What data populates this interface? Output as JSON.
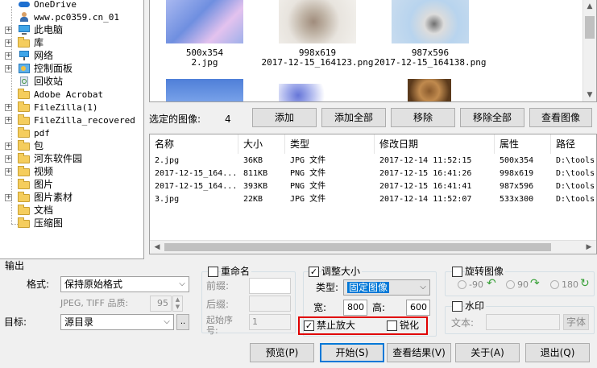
{
  "tree": {
    "items": [
      {
        "label": "OneDrive",
        "icon": "cloud-icon",
        "mono": true,
        "expander": "",
        "indent": 0
      },
      {
        "label": "www.pc0359.cn_01",
        "icon": "user-icon",
        "mono": true,
        "expander": "",
        "indent": 0
      },
      {
        "label": "此电脑",
        "icon": "computer-icon",
        "mono": false,
        "expander": "+",
        "indent": 0
      },
      {
        "label": "库",
        "icon": "library-folder-icon",
        "mono": false,
        "expander": "+",
        "indent": 0
      },
      {
        "label": "网络",
        "icon": "network-icon",
        "mono": false,
        "expander": "+",
        "indent": 0
      },
      {
        "label": "控制面板",
        "icon": "control-panel-icon",
        "mono": false,
        "expander": "+",
        "indent": 0
      },
      {
        "label": "回收站",
        "icon": "recycle-bin-icon",
        "mono": false,
        "expander": "",
        "indent": 0
      },
      {
        "label": "Adobe Acrobat",
        "icon": "folder-icon",
        "mono": true,
        "expander": "",
        "indent": 0
      },
      {
        "label": "FileZilla(1)",
        "icon": "folder-icon",
        "mono": true,
        "expander": "+",
        "indent": 0
      },
      {
        "label": "FileZilla_recovered",
        "icon": "folder-icon",
        "mono": true,
        "expander": "+",
        "indent": 0
      },
      {
        "label": "pdf",
        "icon": "folder-icon",
        "mono": true,
        "expander": "",
        "indent": 0
      },
      {
        "label": "包",
        "icon": "folder-icon",
        "mono": false,
        "expander": "+",
        "indent": 0
      },
      {
        "label": "河东软件园",
        "icon": "folder-icon",
        "mono": false,
        "expander": "+",
        "indent": 0
      },
      {
        "label": "视频",
        "icon": "folder-icon",
        "mono": false,
        "expander": "+",
        "indent": 0
      },
      {
        "label": "图片",
        "icon": "folder-icon",
        "mono": false,
        "expander": "",
        "indent": 0
      },
      {
        "label": "图片素材",
        "icon": "folder-icon",
        "mono": false,
        "expander": "+",
        "indent": 0
      },
      {
        "label": "文档",
        "icon": "folder-icon",
        "mono": false,
        "expander": "",
        "indent": 0
      },
      {
        "label": "压缩图",
        "icon": "folder-icon",
        "mono": false,
        "expander": "",
        "indent": 0
      }
    ]
  },
  "thumbs": [
    {
      "size": "500x354",
      "name": "2.jpg",
      "color": "#8fa8e8"
    },
    {
      "size": "998x619",
      "name": "2017-12-15_164123.png",
      "color": "#d8d2c8"
    },
    {
      "size": "987x596",
      "name": "2017-12-15_164138.png",
      "color": "#b9d0e8"
    }
  ],
  "selected": {
    "label": "选定的图像:",
    "count": "4"
  },
  "buttons": {
    "add": "添加",
    "add_all": "添加全部",
    "remove": "移除",
    "remove_all": "移除全部",
    "view": "查看图像"
  },
  "list": {
    "headers": [
      "名称",
      "大小",
      "类型",
      "修改日期",
      "属性",
      "路径"
    ],
    "rows": [
      [
        "2.jpg",
        "36KB",
        "JPG 文件",
        "2017-12-14 11:52:15",
        "500x354",
        "D:\\tools"
      ],
      [
        "2017-12-15_164...",
        "811KB",
        "PNG 文件",
        "2017-12-15 16:41:26",
        "998x619",
        "D:\\tools"
      ],
      [
        "2017-12-15_164...",
        "393KB",
        "PNG 文件",
        "2017-12-15 16:41:41",
        "987x596",
        "D:\\tools"
      ],
      [
        "3.jpg",
        "22KB",
        "JPG 文件",
        "2017-12-14 11:52:07",
        "533x300",
        "D:\\tools"
      ]
    ]
  },
  "output": {
    "title": "输出",
    "format_label": "格式:",
    "format_value": "保持原始格式",
    "quality_label": "JPEG, TIFF 品质:",
    "quality_value": "95",
    "target_label": "目标:",
    "target_value": "源目录",
    "browse": ".."
  },
  "rename": {
    "label": "重命名",
    "prefix": "前缀:",
    "suffix": "后缀:",
    "start_seq": "起始序号:",
    "start_value": "1"
  },
  "resize": {
    "label": "调整大小",
    "type_label": "类型:",
    "type_value": "固定图像",
    "width_label": "宽:",
    "width_value": "800",
    "height_label": "高:",
    "height_value": "600",
    "no_enlarge": "禁止放大",
    "sharpen": "锐化",
    "highlight_color": "#e00000"
  },
  "rotate": {
    "label": "旋转图像",
    "opt1": "-90",
    "opt2": "90",
    "opt3": "180"
  },
  "watermark": {
    "label": "水印",
    "text_label": "文本:",
    "font_button": "字体"
  },
  "actions": {
    "preview": "预览(P)",
    "start": "开始(S)",
    "view_result": "查看结果(V)",
    "about": "关于(A)",
    "exit": "退出(Q)"
  },
  "accent": "#0078d7"
}
